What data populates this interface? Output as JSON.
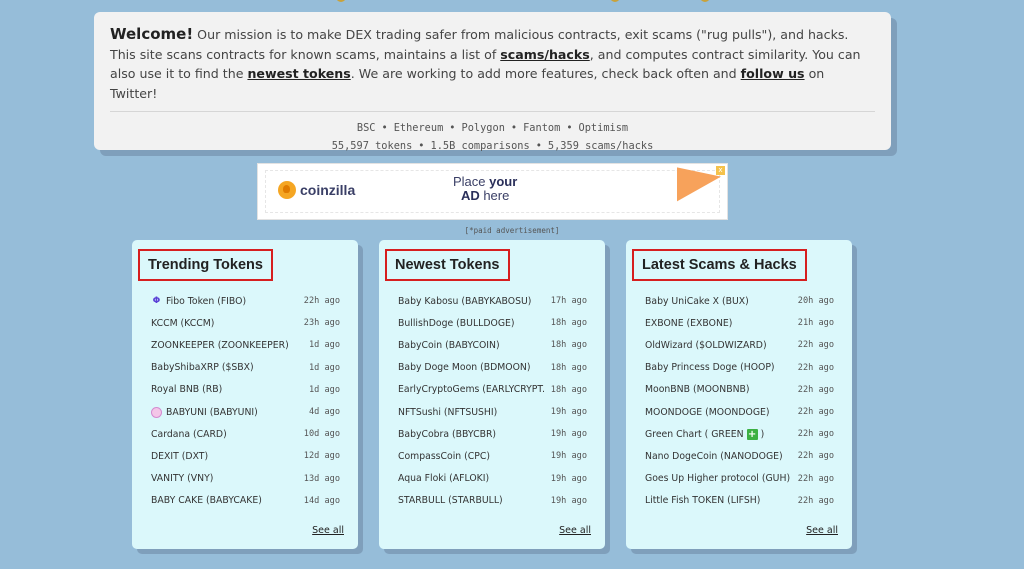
{
  "welcome": {
    "lead": "Welcome!",
    "text_1": " Our mission is to make DEX trading safer from malicious contracts, exit scams (\"rug pulls\"), and hacks. This site scans contracts for known scams, maintains a list of ",
    "link_scams": "scams/hacks",
    "text_2": ", and computes contract similarity. You can also use it to find the ",
    "link_newest": "newest tokens",
    "text_3": ". We are working to add more features, check back often and ",
    "link_follow": "follow us",
    "text_4": " on Twitter!"
  },
  "chains": [
    "BSC",
    "Ethereum",
    "Polygon",
    "Fantom",
    "Optimism"
  ],
  "stats": [
    "55,597 tokens",
    "1.5B comparisons",
    "5,359 scams/hacks"
  ],
  "ad": {
    "brand": "coinzilla",
    "place_line_1": "Place ",
    "place_line_1_bold": "your",
    "place_line_2_bold": "AD",
    "place_line_2": " here",
    "close": "x",
    "caption": "[*paid advertisement]"
  },
  "trending": {
    "title": "Trending Tokens",
    "see_all": "See all",
    "items": [
      {
        "name": "Fibo Token (FIBO)",
        "age": "22h ago",
        "icon": "fibo-icon"
      },
      {
        "name": "KCCM (KCCM)",
        "age": "23h ago"
      },
      {
        "name": "ZOONKEEPER (ZOONKEEPER)",
        "age": "1d ago"
      },
      {
        "name": "BabyShibaXRP ($SBX)",
        "age": "1d ago"
      },
      {
        "name": "Royal BNB (RB)",
        "age": "1d ago"
      },
      {
        "name": "BABYUNI (BABYUNI)",
        "age": "4d ago",
        "icon": "babyuni-icon"
      },
      {
        "name": "Cardana (CARD)",
        "age": "10d ago"
      },
      {
        "name": "DEXIT (DXT)",
        "age": "12d ago"
      },
      {
        "name": "VANITY (VNY)",
        "age": "13d ago"
      },
      {
        "name": "BABY CAKE (BABYCAKE)",
        "age": "14d ago"
      }
    ]
  },
  "newest": {
    "title": "Newest Tokens",
    "see_all": "See all",
    "items": [
      {
        "name": "Baby Kabosu (BABYKABOSU)",
        "age": "17h ago"
      },
      {
        "name": "BullishDoge (BULLDOGE)",
        "age": "18h ago"
      },
      {
        "name": "BabyCoin (BABYCOIN)",
        "age": "18h ago"
      },
      {
        "name": "Baby Doge Moon (BDMOON)",
        "age": "18h ago"
      },
      {
        "name": "EarlyCryptoGems (EARLYCRYPT...",
        "age": "18h ago"
      },
      {
        "name": "NFTSushi (NFTSUSHI)",
        "age": "19h ago"
      },
      {
        "name": "BabyCobra (BBYCBR)",
        "age": "19h ago"
      },
      {
        "name": "CompassCoin (CPC)",
        "age": "19h ago"
      },
      {
        "name": "Aqua Floki (AFLOKI)",
        "age": "19h ago"
      },
      {
        "name": "STARBULL (STARBULL)",
        "age": "19h ago"
      }
    ]
  },
  "scams": {
    "title": "Latest Scams & Hacks",
    "see_all": "See all",
    "items": [
      {
        "name": "Baby UniCake X (BUX)",
        "age": "20h ago"
      },
      {
        "name": "EXBONE (EXBONE)",
        "age": "21h ago"
      },
      {
        "name": "OldWizard ($OLDWIZARD)",
        "age": "22h ago"
      },
      {
        "name": "Baby Princess Doge (HOOP)",
        "age": "22h ago"
      },
      {
        "name": "MoonBNB (MOONBNB)",
        "age": "22h ago"
      },
      {
        "name": "MOONDOGE (MOONDOGE)",
        "age": "22h ago"
      },
      {
        "name": "Green Chart ( GREEN ",
        "name_suffix": ")",
        "age": "22h ago",
        "emoji": "+"
      },
      {
        "name": "Nano DogeCoin (NANODOGE)",
        "age": "22h ago"
      },
      {
        "name": "Goes Up Higher protocol (GUH)",
        "age": "22h ago"
      },
      {
        "name": "Little Fish TOKEN (LIFSH)",
        "age": "22h ago"
      }
    ]
  },
  "colors": {
    "background": "#96bdd9",
    "card": "#dbf8fb",
    "highlight_border": "#d61f1f",
    "welcome_card": "#f2f2f2"
  }
}
